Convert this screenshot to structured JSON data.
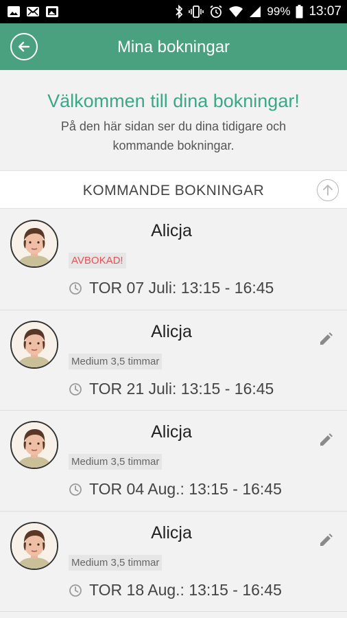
{
  "status_bar": {
    "battery": "99%",
    "time": "13:07",
    "icons": [
      "image-notification-icon",
      "mail-notification-icon",
      "photo-notification-icon",
      "bluetooth-icon",
      "vibrate-icon",
      "alarm-icon",
      "wifi-icon",
      "signal-icon",
      "battery-icon"
    ]
  },
  "app_bar": {
    "title": "Mina bokningar",
    "back_icon": "back-arrow-icon"
  },
  "welcome": {
    "title": "Välkommen till dina bokningar!",
    "text": "På den här sidan ser du dina tidigare och kommande bokningar."
  },
  "section": {
    "title": "KOMMANDE BOKNINGAR",
    "scroll_icon": "arrow-up-circle-icon"
  },
  "bookings": [
    {
      "name": "Alicja",
      "status": "AVBOKAD!",
      "time": "TOR 07 Juli: 13:15 - 16:45",
      "editable": false
    },
    {
      "name": "Alicja",
      "status": "Medium 3,5 timmar",
      "time": "TOR 21 Juli: 13:15 - 16:45",
      "editable": true
    },
    {
      "name": "Alicja",
      "status": "Medium 3,5 timmar",
      "time": "TOR 04 Aug.: 13:15 - 16:45",
      "editable": true
    },
    {
      "name": "Alicja",
      "status": "Medium 3,5 timmar",
      "time": "TOR 18 Aug.: 13:15 - 16:45",
      "editable": true
    }
  ],
  "colors": {
    "accent": "#4aa17f",
    "welcome_title": "#3aa887",
    "cancelled": "#e05454"
  }
}
